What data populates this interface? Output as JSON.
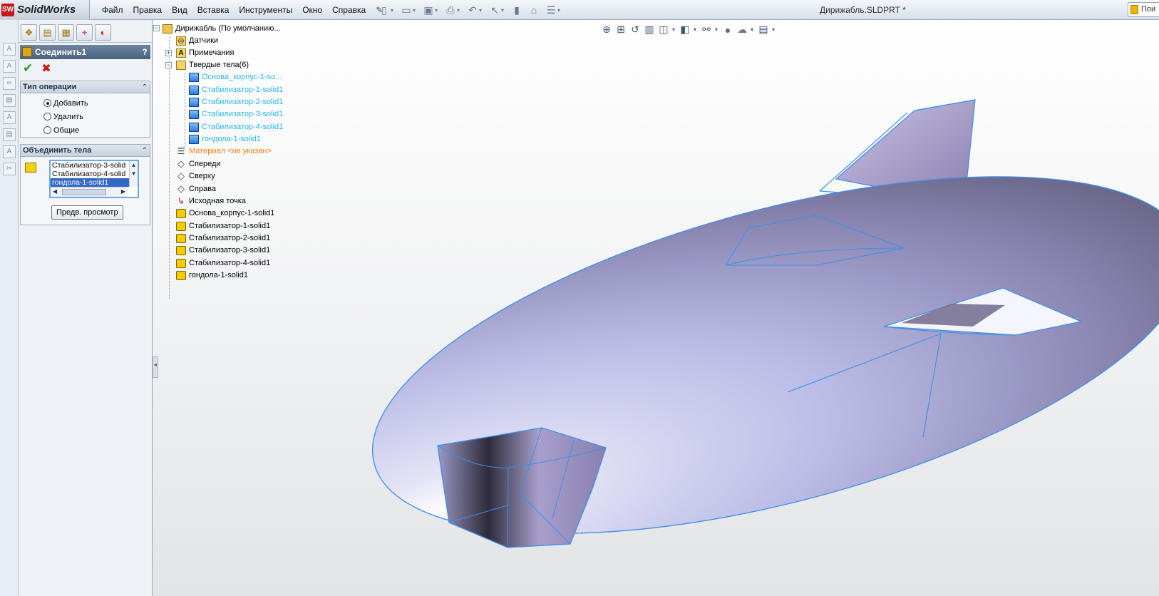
{
  "app": {
    "logo_badge": "SW",
    "logo_text": "SolidWorks"
  },
  "menu": [
    "Файл",
    "Правка",
    "Вид",
    "Вставка",
    "Инструменты",
    "Окно",
    "Справка"
  ],
  "document_title": "Дирижабль.SLDPRT *",
  "search_placeholder": "Пои",
  "property_manager": {
    "title": "Соединить1",
    "help": "?",
    "operation_group": {
      "title": "Тип операции",
      "options": [
        {
          "label": "Добавить",
          "selected": true
        },
        {
          "label": "Удалить",
          "selected": false
        },
        {
          "label": "Общие",
          "selected": false
        }
      ]
    },
    "bodies_group": {
      "title": "Объединить тела",
      "items": [
        "Стабилизатор-3-solid",
        "Стабилизатор-4-solid",
        "гондола-1-solid1"
      ],
      "selected_index": 2
    },
    "preview_button": "Предв. просмотр"
  },
  "feature_tree": {
    "root": "Дирижабль  (По умолчанию...",
    "sensors": "Датчики",
    "annotations": "Примечания",
    "solid_bodies": "Твердые тела(6)",
    "bodies": [
      "Основа_корпус-1-so...",
      "Стабилизатор-1-solid1",
      "Стабилизатор-2-solid1",
      "Стабилизатор-3-solid1",
      "Стабилизатор-4-solid1",
      "гондола-1-solid1"
    ],
    "material": "Материал <не указан>",
    "planes": [
      "Спереди",
      "Сверху",
      "Справа"
    ],
    "origin": "Исходная точка",
    "features": [
      "Основа_корпус-1-solid1",
      "Стабилизатор-1-solid1",
      "Стабилизатор-2-solid1",
      "Стабилизатор-3-solid1",
      "Стабилизатор-4-solid1",
      "гондола-1-solid1"
    ]
  },
  "colors": {
    "selected_body_text": "#27b6ea",
    "material_text": "#f07e12",
    "edge_highlight": "#3d8fe8",
    "hull": "#bbbde6"
  }
}
